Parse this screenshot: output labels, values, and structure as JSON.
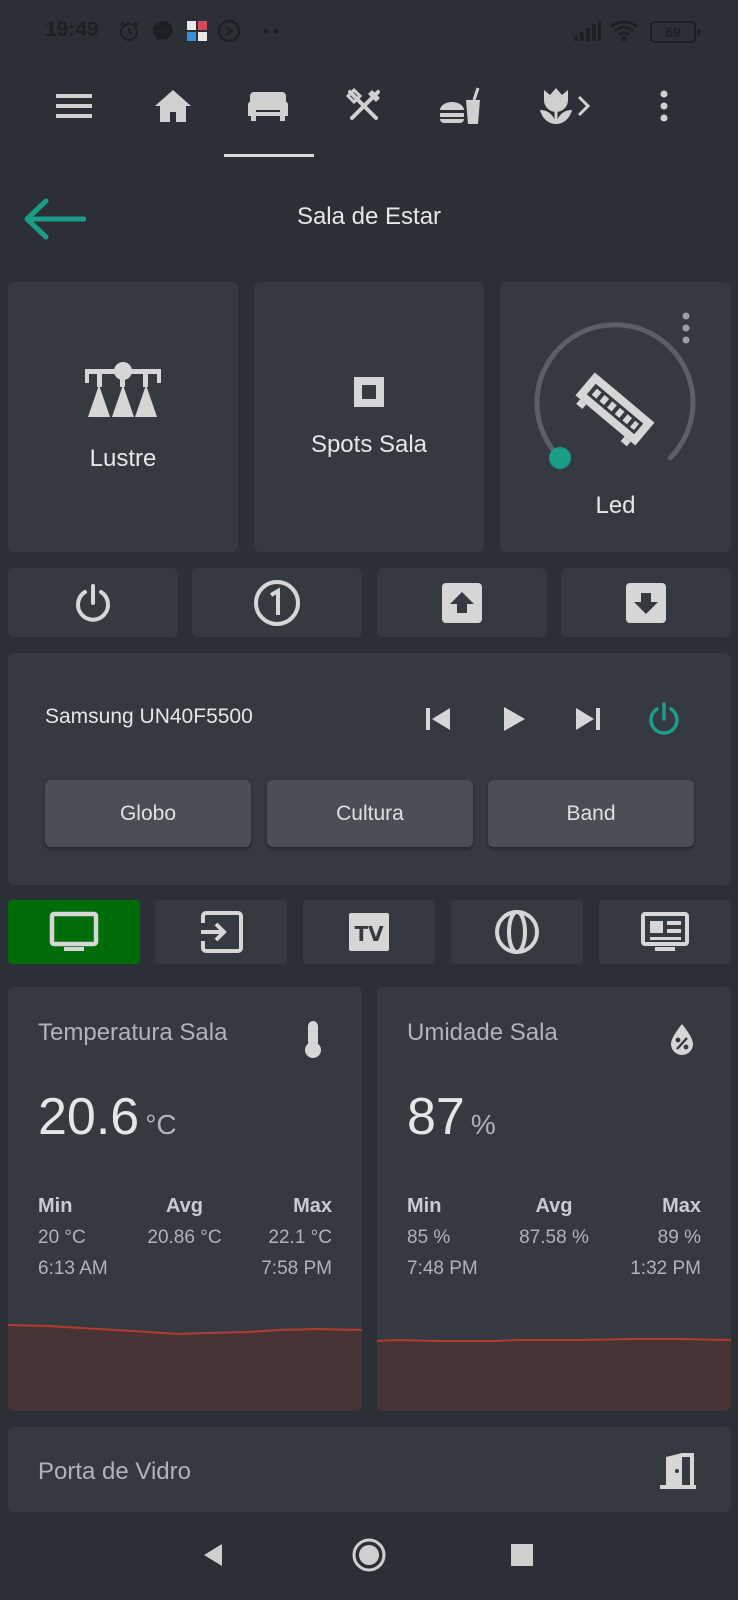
{
  "status_bar": {
    "time": "19:49",
    "battery": "69"
  },
  "nav": {
    "items": [
      "menu-icon",
      "home-icon",
      "sofa-icon",
      "utensils-icon",
      "burger-drink-icon",
      "tulip-icon",
      "chevron-right-icon",
      "more-vert-icon"
    ],
    "active": "sofa-icon"
  },
  "header": {
    "title": "Sala de Estar",
    "accent": "#1a9e8a"
  },
  "lights": [
    {
      "label": "Lustre",
      "icon": "chandelier-icon"
    },
    {
      "label": "Spots Sala",
      "icon": "stop-square-icon"
    },
    {
      "label": "Led",
      "icon": "led-strip-icon",
      "brightness_fraction": 0.0
    }
  ],
  "controls": [
    "power-icon",
    "numeric-one-circle-icon",
    "arrow-up-box-icon",
    "arrow-down-box-icon"
  ],
  "media": {
    "title": "Samsung UN40F5500",
    "channels": [
      "Globo",
      "Cultura",
      "Band"
    ],
    "power_color": "#1a9e8a"
  },
  "sources": {
    "items": [
      "monitor-icon",
      "input-icon",
      "tv-icon",
      "globe-icon",
      "newspaper-icon"
    ],
    "active_color": "#016d0a"
  },
  "temperature": {
    "title": "Temperatura Sala",
    "value": "20.6",
    "unit": "°C",
    "min_label": "Min",
    "avg_label": "Avg",
    "max_label": "Max",
    "min": "20 °C",
    "avg": "20.86 °C",
    "max": "22.1 °C",
    "min_time": "6:13 AM",
    "max_time": "7:58 PM"
  },
  "humidity": {
    "title": "Umidade Sala",
    "value": "87",
    "unit": "%",
    "min_label": "Min",
    "avg_label": "Avg",
    "max_label": "Max",
    "min": "85 %",
    "avg": "87.58 %",
    "max": "89 %",
    "min_time": "7:48 PM",
    "max_time": "1:32 PM"
  },
  "door": {
    "title": "Porta de Vidro"
  },
  "colors": {
    "background": "#2c2f35",
    "card": "#353a41",
    "spark_line": "#b23a30",
    "spark_fill": "#473234"
  }
}
